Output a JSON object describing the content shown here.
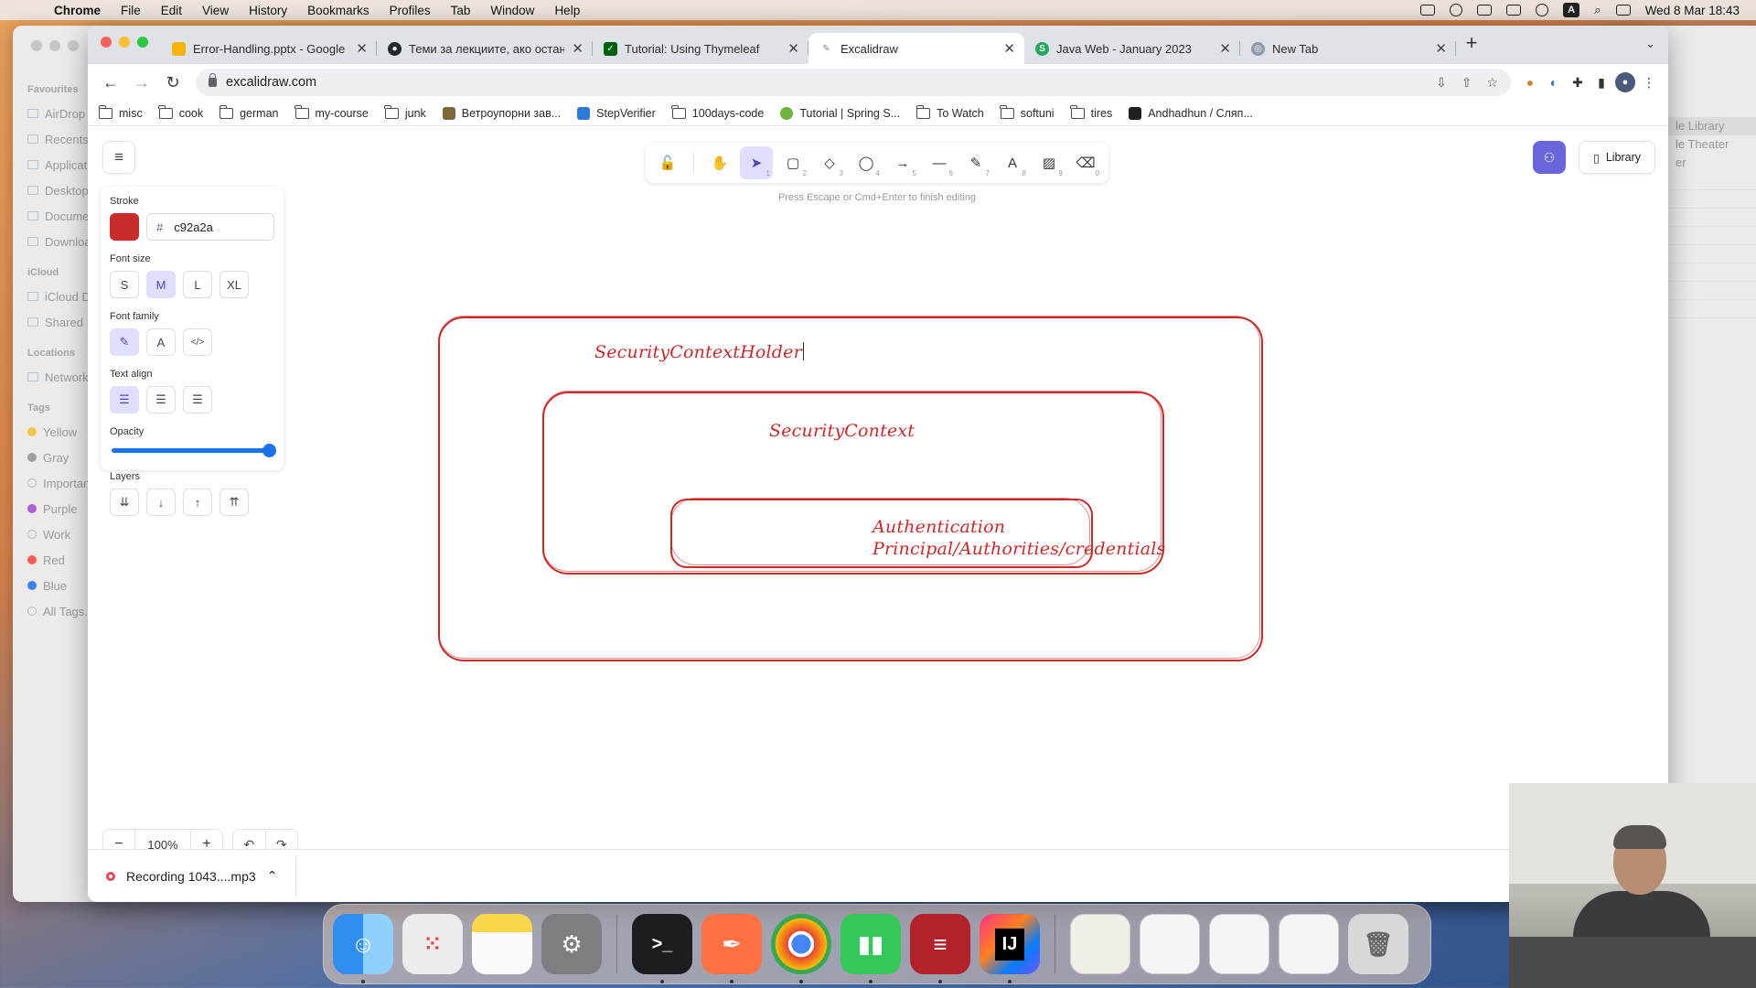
{
  "menubar": {
    "app": "Chrome",
    "items": [
      "File",
      "Edit",
      "View",
      "History",
      "Bookmarks",
      "Profiles",
      "Tab",
      "Window",
      "Help"
    ],
    "clock": "Wed 8 Mar  18:43"
  },
  "finder": {
    "favourites_label": "Favourites",
    "favourites": [
      "AirDrop",
      "Recents",
      "Applications",
      "Desktop",
      "Documents",
      "Downloads"
    ],
    "icloud_label": "iCloud",
    "icloud": [
      "iCloud Drive",
      "Shared"
    ],
    "locations_label": "Locations",
    "locations": [
      "Network"
    ],
    "tags_label": "Tags",
    "tags": [
      {
        "name": "Yellow",
        "color": "#f5c542"
      },
      {
        "name": "Gray",
        "color": "#9e9e9e"
      },
      {
        "name": "Important",
        "color": "#ffffff"
      },
      {
        "name": "Purple",
        "color": "#b05fd6"
      },
      {
        "name": "Work",
        "color": "#ffffff"
      },
      {
        "name": "Red",
        "color": "#ff5a5a"
      },
      {
        "name": "Blue",
        "color": "#3b82f6"
      },
      {
        "name": "All Tags...",
        "color": "#ffffff"
      }
    ],
    "right_items": [
      "le Library",
      "le Theater",
      "er"
    ]
  },
  "tabs": [
    {
      "title": "Error-Handling.pptx - Google S",
      "fav_color": "#f4b400",
      "fav_glyph": ""
    },
    {
      "title": "Теми за лекциите, ако останe",
      "fav_color": "#24292f",
      "fav_glyph": "●"
    },
    {
      "title": "Tutorial: Using Thymeleaf",
      "fav_color": "#005f0f",
      "fav_glyph": "✓"
    },
    {
      "title": "Excalidraw",
      "fav_color": "#ffffff",
      "fav_glyph": "✎",
      "active": true
    },
    {
      "title": "Java Web - January 2023",
      "fav_color": "#25a55f",
      "fav_glyph": "S"
    },
    {
      "title": "New Tab",
      "fav_color": "#8e9aa8",
      "fav_glyph": "◎"
    }
  ],
  "address": {
    "url": "excalidraw.com"
  },
  "bookmarks": [
    {
      "label": "misc",
      "type": "folder"
    },
    {
      "label": "cook",
      "type": "folder"
    },
    {
      "label": "german",
      "type": "folder"
    },
    {
      "label": "my-course",
      "type": "folder"
    },
    {
      "label": "junk",
      "type": "folder"
    },
    {
      "label": "Ветроупорни зав...",
      "type": "site",
      "color": "#7a6a3a"
    },
    {
      "label": "StepVerifier",
      "type": "site",
      "color": "#2a7bd8"
    },
    {
      "label": "100days-code",
      "type": "folder"
    },
    {
      "label": "Tutorial | Spring S...",
      "type": "site",
      "color": "#6db33f"
    },
    {
      "label": "To Watch",
      "type": "folder"
    },
    {
      "label": "softuni",
      "type": "folder"
    },
    {
      "label": "tires",
      "type": "folder"
    },
    {
      "label": "Andhadhun / Сляп...",
      "type": "site",
      "color": "#1f1f1f"
    }
  ],
  "excalidraw": {
    "toolbar_hint": "Press Escape or Cmd+Enter to finish editing",
    "tools": [
      {
        "name": "lock",
        "glyph": "🔓",
        "key": ""
      },
      {
        "name": "hand",
        "glyph": "✋",
        "key": ""
      },
      {
        "name": "selection",
        "glyph": "➤",
        "key": "1",
        "active": true
      },
      {
        "name": "rectangle",
        "glyph": "▢",
        "key": "2"
      },
      {
        "name": "diamond",
        "glyph": "◇",
        "key": "3"
      },
      {
        "name": "ellipse",
        "glyph": "◯",
        "key": "4"
      },
      {
        "name": "arrow",
        "glyph": "→",
        "key": "5"
      },
      {
        "name": "line",
        "glyph": "—",
        "key": "6"
      },
      {
        "name": "draw",
        "glyph": "✎",
        "key": "7"
      },
      {
        "name": "text",
        "glyph": "A",
        "key": "8"
      },
      {
        "name": "image",
        "glyph": "▨",
        "key": "9"
      },
      {
        "name": "eraser",
        "glyph": "⌫",
        "key": "0"
      }
    ],
    "library_label": "Library",
    "props": {
      "stroke_label": "Stroke",
      "stroke_hash": "#",
      "stroke_hex": "c92a2a",
      "stroke_color": "#c92a2a",
      "font_size_label": "Font size",
      "font_sizes": [
        "S",
        "M",
        "L",
        "XL"
      ],
      "font_size_selected": "M",
      "font_family_label": "Font family",
      "font_families": [
        "✎",
        "A",
        "</>"
      ],
      "text_align_label": "Text align",
      "text_aligns": [
        "≡",
        "≡",
        "≡"
      ],
      "opacity_label": "Opacity",
      "opacity_value": 1.0,
      "layers_label": "Layers",
      "layers": [
        "⇊",
        "↓",
        "↑",
        "⇈"
      ]
    },
    "diagram": {
      "outer_label": "SecurityContextHolder",
      "middle_label": "SecurityContext",
      "inner_line1": "Authentication",
      "inner_line2": "Principal/Authorities/credentials"
    },
    "zoom": {
      "value": "100%",
      "minus": "−",
      "plus": "+"
    },
    "undo": "↶",
    "redo": "↷"
  },
  "download": {
    "filename": "Recording 1043....mp3"
  },
  "dock": [
    {
      "name": "finder",
      "color": "#3b8ff0",
      "glyph": "☺"
    },
    {
      "name": "launchpad",
      "color": "#e8e8ea",
      "glyph": "⋮⋮"
    },
    {
      "name": "notes",
      "color": "#f6d84a",
      "glyph": ""
    },
    {
      "name": "system-settings",
      "color": "#8e8e93",
      "glyph": "⚙"
    },
    {
      "name": "terminal",
      "color": "#1d1d1f",
      "glyph": ">_"
    },
    {
      "name": "script-editor",
      "color": "#ff7043",
      "glyph": "✒"
    },
    {
      "name": "chrome",
      "color": "#ea4335",
      "glyph": "◉"
    },
    {
      "name": "numbers",
      "color": "#34c759",
      "glyph": "▮▮"
    },
    {
      "name": "database",
      "color": "#b3222a",
      "glyph": "≡"
    },
    {
      "name": "intellij",
      "color": "#1f1f1f",
      "glyph": "IJ"
    },
    {
      "name": "recent-doc",
      "color": "#f2efe8",
      "glyph": ""
    },
    {
      "name": "recent-screenshot",
      "color": "#f5f5f5",
      "glyph": ""
    },
    {
      "name": "recent-sheet",
      "color": "#f5f5f5",
      "glyph": ""
    },
    {
      "name": "recent-db",
      "color": "#f5f5f5",
      "glyph": ""
    },
    {
      "name": "trash",
      "color": "#d8d8d8",
      "glyph": "🗑"
    }
  ]
}
